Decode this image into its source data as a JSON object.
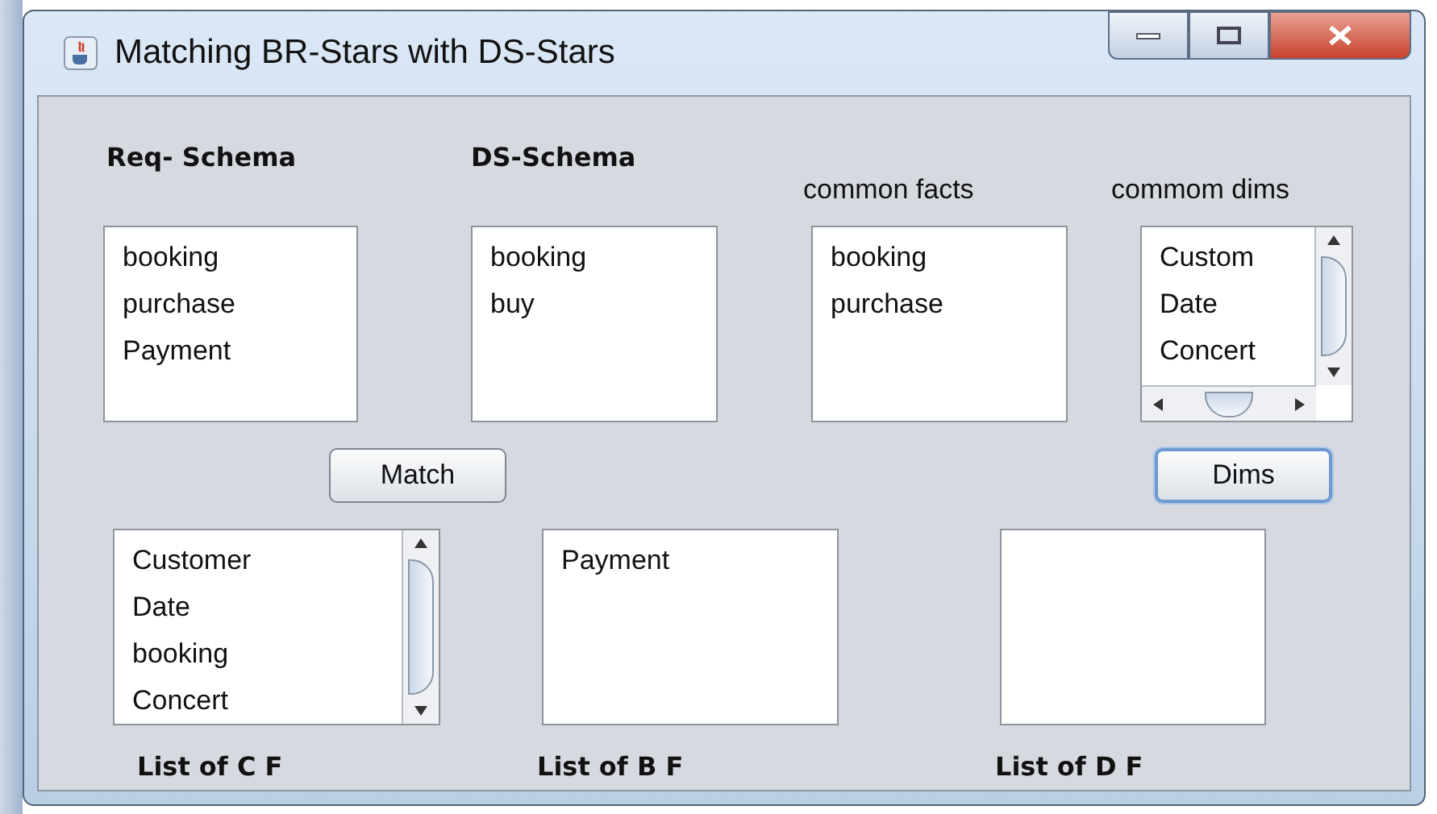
{
  "window": {
    "title": "Matching BR-Stars with DS-Stars"
  },
  "top_lists": [
    {
      "heading": "Req- Schema",
      "heading_bold": true,
      "kind": "plain",
      "items": [
        "booking",
        "purchase",
        "Payment"
      ]
    },
    {
      "heading": "DS-Schema",
      "heading_bold": true,
      "kind": "plain",
      "items": [
        "booking",
        "buy"
      ]
    },
    {
      "heading": "common facts",
      "heading_bold": false,
      "kind": "plain",
      "items": [
        "booking",
        "purchase"
      ]
    },
    {
      "heading": "commom dims",
      "heading_bold": false,
      "kind": "scroll-both",
      "items": [
        "Custom",
        "Date",
        "Concert"
      ]
    }
  ],
  "buttons": [
    {
      "label": "Match",
      "focused": false
    },
    {
      "label": "Dims",
      "focused": true
    }
  ],
  "bottom_lists": [
    {
      "label": "List of C F",
      "kind": "scroll-v",
      "items": [
        "Customer",
        "Date",
        "booking",
        "Concert"
      ]
    },
    {
      "label": "List of B F",
      "kind": "plain",
      "items": [
        "Payment"
      ]
    },
    {
      "label": "List of D F",
      "kind": "plain"
    }
  ]
}
